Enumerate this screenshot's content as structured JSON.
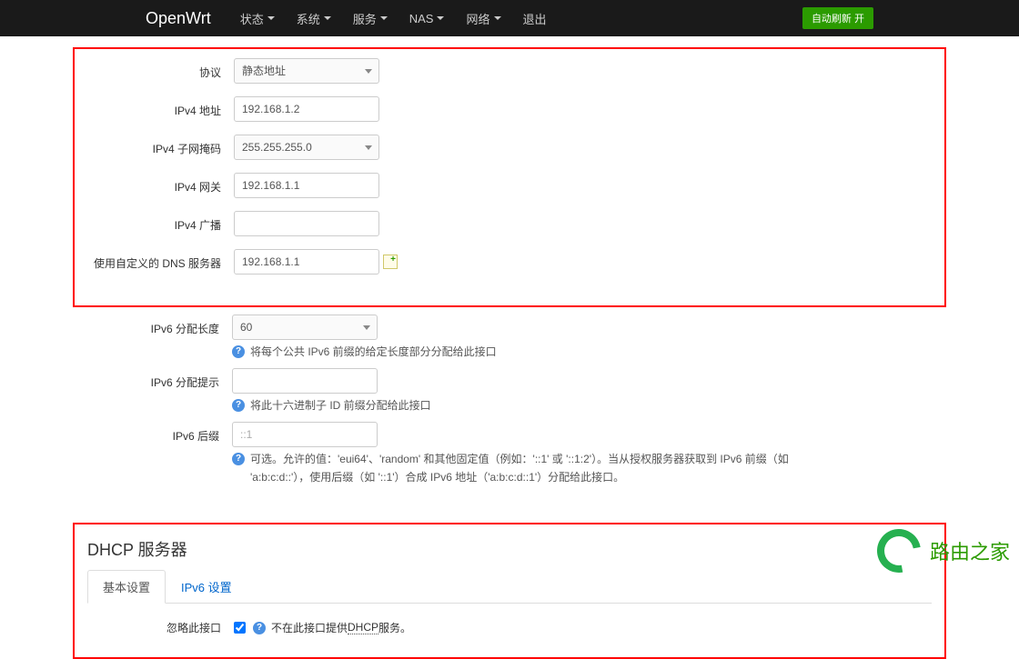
{
  "navbar": {
    "brand": "OpenWrt",
    "items": [
      "状态",
      "系统",
      "服务",
      "NAS",
      "网络"
    ],
    "logout": "退出",
    "auto_refresh": "自动刷新 开"
  },
  "form": {
    "protocol": {
      "label": "协议",
      "value": "静态地址"
    },
    "ipv4_addr": {
      "label": "IPv4 地址",
      "value": "192.168.1.2"
    },
    "ipv4_mask": {
      "label": "IPv4 子网掩码",
      "value": "255.255.255.0"
    },
    "ipv4_gateway": {
      "label": "IPv4 网关",
      "value": "192.168.1.1"
    },
    "ipv4_broadcast": {
      "label": "IPv4 广播",
      "value": ""
    },
    "custom_dns": {
      "label": "使用自定义的 DNS 服务器",
      "value": "192.168.1.1"
    },
    "ipv6_prefix_len": {
      "label": "IPv6 分配长度",
      "value": "60",
      "help": "将每个公共 IPv6 前缀的给定长度部分分配给此接口"
    },
    "ipv6_prefix_hint": {
      "label": "IPv6 分配提示",
      "value": "",
      "help": "将此十六进制子 ID 前缀分配给此接口"
    },
    "ipv6_suffix": {
      "label": "IPv6 后缀",
      "placeholder": "::1",
      "help": "可选。允许的值：'eui64'、'random' 和其他固定值（例如：'::1' 或 '::1:2'）。当从授权服务器获取到 IPv6 前缀（如 'a:b:c:d::'），使用后缀（如 '::1'）合成 IPv6 地址（'a:b:c:d::1'）分配给此接口。"
    }
  },
  "dhcp": {
    "title": "DHCP 服务器",
    "tabs": {
      "basic": "基本设置",
      "ipv6": "IPv6 设置"
    },
    "ignore": {
      "label": "忽略此接口",
      "checked": true,
      "help_prefix": "不在此接口提供 ",
      "help_dotted": "DHCP",
      "help_suffix": " 服务。"
    }
  },
  "watermark": "路由之家"
}
